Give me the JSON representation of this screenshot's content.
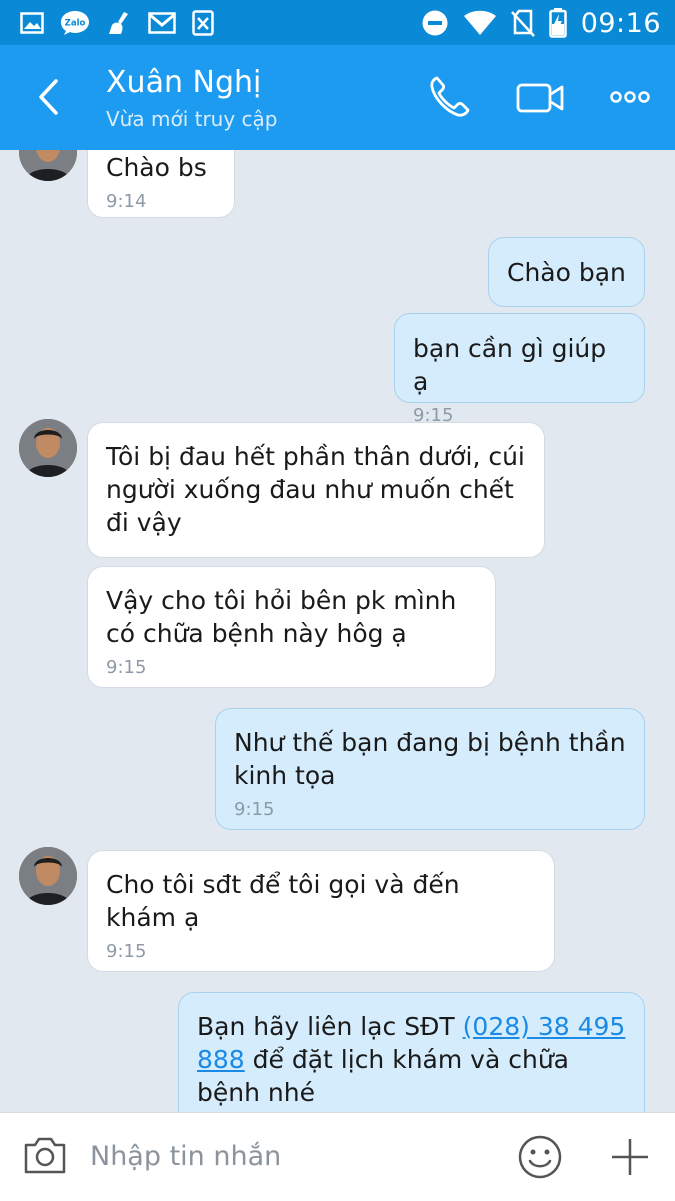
{
  "status_bar": {
    "time": "09:16",
    "left_icons": [
      "gallery-icon",
      "zalo-icon",
      "cleaner-icon",
      "gmail-icon",
      "excel-icon"
    ],
    "right_icons": [
      "do-not-disturb-icon",
      "wifi-icon",
      "no-sim-icon",
      "battery-charging-icon"
    ]
  },
  "header": {
    "contact_name": "Xuân Nghị",
    "status": "Vừa mới truy cập",
    "color": "#1d9bf0"
  },
  "messages": [
    {
      "from": "contact",
      "text": "Chào bs",
      "time": "9:14"
    },
    {
      "from": "me",
      "text": "Chào bạn",
      "time": ""
    },
    {
      "from": "me",
      "text": "bạn cần gì giúp ạ",
      "time": "9:15"
    },
    {
      "from": "contact",
      "text": "Tôi bị đau hết phần thân dưới, cúi người xuống đau như muốn chết đi vậy",
      "time": ""
    },
    {
      "from": "contact",
      "text": "Vậy cho tôi hỏi bên pk mình có chữa bệnh này hôg ạ",
      "time": "9:15"
    },
    {
      "from": "me",
      "text": "Như thế bạn đang bị bệnh thần kinh tọa",
      "time": "9:15"
    },
    {
      "from": "contact",
      "text": "Cho tôi sđt để tôi gọi và đến khám ạ",
      "time": "9:15"
    },
    {
      "from": "me",
      "text_before": "Bạn hãy liên lạc SĐT ",
      "phone_link": "(028) 38 495 888",
      "text_after": " để đặt lịch khám và chữa bệnh nhé",
      "time": ""
    }
  ],
  "input_bar": {
    "placeholder": "Nhập tin nhắn"
  },
  "colors": {
    "incoming_bubble": "#ffffff",
    "outgoing_bubble": "#d4ecfc",
    "chat_background": "#e2e8f0",
    "link": "#1a8ae6"
  }
}
